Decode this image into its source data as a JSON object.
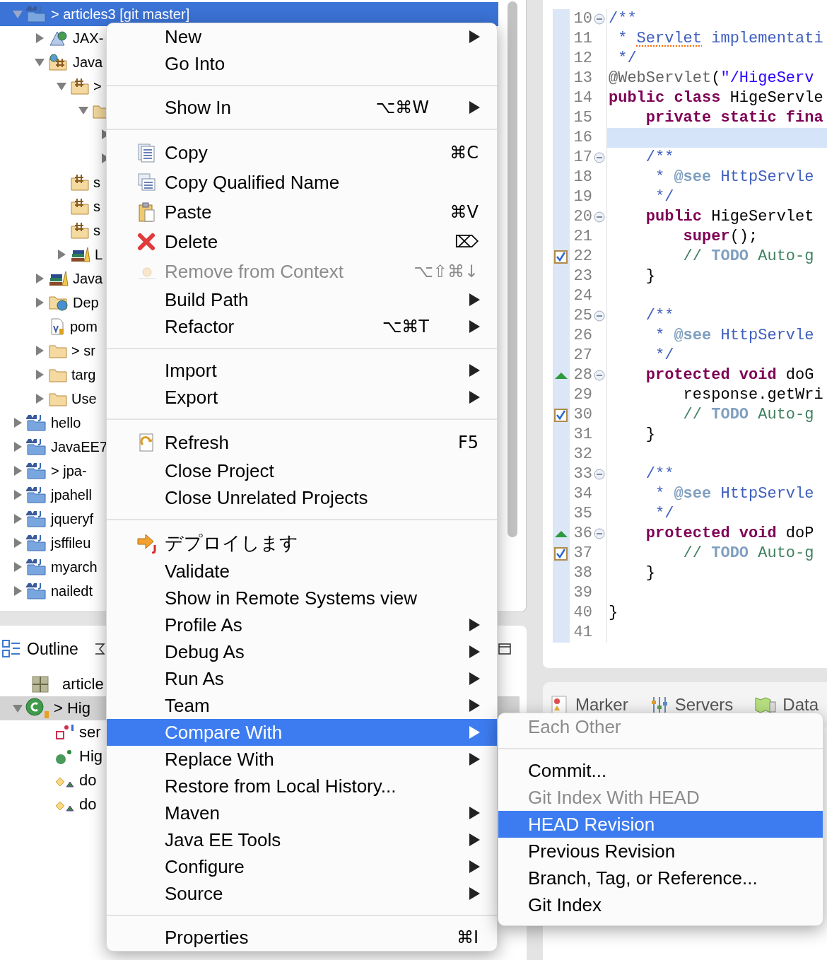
{
  "explorer": {
    "tree": [
      {
        "label": "> articles3 [git master]",
        "kind": "project",
        "expanded": true,
        "selected": true,
        "children": [
          {
            "label": "JAX-",
            "kind": "webservice",
            "expanded": false,
            "selected": false
          },
          {
            "label": "Java",
            "kind": "resources",
            "expanded": true,
            "selected": false,
            "children": [
              {
                "label": ">",
                "kind": "package-root",
                "expanded": true,
                "selected": false,
                "children": [
                  {
                    "kind": "package",
                    "expanded": true,
                    "selected": false,
                    "children": [
                      {
                        "expanded": false,
                        "selected": false
                      },
                      {
                        "expanded": false,
                        "selected": false
                      }
                    ]
                  }
                ]
              },
              {
                "label": "s",
                "kind": "package-root",
                "selected": false
              },
              {
                "label": "s",
                "kind": "package-root",
                "selected": false
              },
              {
                "label": "s",
                "kind": "package-root",
                "selected": false
              },
              {
                "label": "L",
                "kind": "library",
                "expanded": false,
                "selected": false
              }
            ]
          },
          {
            "label": "Java",
            "kind": "library",
            "expanded": false,
            "selected": false
          },
          {
            "label": "Dep",
            "kind": "deploy",
            "expanded": false,
            "selected": false
          },
          {
            "label": "pom",
            "kind": "file",
            "selected": false
          },
          {
            "label": "> sr",
            "kind": "folder",
            "expanded": false,
            "selected": false
          },
          {
            "label": "targ",
            "kind": "folder",
            "expanded": false,
            "selected": false
          },
          {
            "label": "Use",
            "kind": "folder",
            "expanded": false,
            "selected": false
          }
        ]
      },
      {
        "label": "hello",
        "kind": "project",
        "expanded": false,
        "selected": false
      },
      {
        "label": "JavaEE7",
        "kind": "project",
        "expanded": false,
        "selected": false
      },
      {
        "label": "> jpa-",
        "kind": "project",
        "expanded": false,
        "selected": false
      },
      {
        "label": "jpahell",
        "kind": "project",
        "expanded": false,
        "selected": false
      },
      {
        "label": "jqueryf",
        "kind": "project",
        "expanded": false,
        "selected": false
      },
      {
        "label": "jsffileu",
        "kind": "project",
        "expanded": false,
        "selected": false
      },
      {
        "label": "myarch",
        "kind": "project",
        "expanded": false,
        "selected": false
      },
      {
        "label": "nailedt",
        "kind": "project",
        "expanded": false,
        "selected": false
      }
    ]
  },
  "outline": {
    "title": "Outline",
    "items": [
      {
        "label": "article",
        "kind": "package",
        "selected": false
      },
      {
        "label": "> Hig",
        "kind": "class",
        "expanded": true,
        "selected": true,
        "children": [
          {
            "label": "ser",
            "kind": "field",
            "selected": false
          },
          {
            "label": "Hig",
            "kind": "constructor",
            "selected": false
          },
          {
            "label": "do",
            "kind": "method",
            "selected": false
          },
          {
            "label": "do",
            "kind": "method",
            "selected": false
          }
        ]
      }
    ]
  },
  "editor": {
    "lines": [
      {
        "number": "10",
        "fold": true,
        "current": false,
        "code": [
          {
            "text": "/**",
            "kind": "doc"
          }
        ]
      },
      {
        "number": "11",
        "current": false,
        "code": [
          {
            "text": " * ",
            "kind": "doc"
          },
          {
            "text": "Servlet",
            "kind": "doc",
            "misspelled": true
          },
          {
            "text": " implementati",
            "kind": "doc"
          }
        ]
      },
      {
        "number": "12",
        "current": false,
        "code": [
          {
            "text": " */",
            "kind": "doc"
          }
        ]
      },
      {
        "number": "13",
        "current": false,
        "code": [
          {
            "text": "@WebServlet",
            "kind": "annotation"
          },
          {
            "text": "(",
            "kind": "plain"
          },
          {
            "text": "\"/HigeServ",
            "kind": "string"
          }
        ]
      },
      {
        "number": "14",
        "current": false,
        "code": [
          {
            "text": "public class",
            "kind": "keyword"
          },
          {
            "text": " HigeServle",
            "kind": "plain"
          }
        ]
      },
      {
        "number": "15",
        "current": false,
        "code": [
          {
            "text": "    private static fina",
            "kind": "keyword"
          }
        ]
      },
      {
        "number": "16",
        "current": true
      },
      {
        "number": "17",
        "fold": true,
        "current": false,
        "code": [
          {
            "text": "    /**",
            "kind": "doc"
          }
        ]
      },
      {
        "number": "18",
        "current": false,
        "code": [
          {
            "text": "     * ",
            "kind": "doc"
          },
          {
            "text": "@see",
            "kind": "doctag"
          },
          {
            "text": " HttpServle",
            "kind": "doc"
          }
        ]
      },
      {
        "number": "19",
        "current": false,
        "code": [
          {
            "text": "     */",
            "kind": "doc"
          }
        ]
      },
      {
        "number": "20",
        "fold": true,
        "current": false,
        "code": [
          {
            "text": "    public",
            "kind": "keyword"
          },
          {
            "text": " HigeServlet",
            "kind": "plain"
          }
        ]
      },
      {
        "number": "21",
        "current": false,
        "code": [
          {
            "text": "        super",
            "kind": "keyword"
          },
          {
            "text": "();",
            "kind": "plain"
          }
        ]
      },
      {
        "number": "22",
        "kind": "task",
        "current": false,
        "code": [
          {
            "text": "        // ",
            "kind": "comment"
          },
          {
            "text": "TODO",
            "kind": "todo"
          },
          {
            "text": " Auto-g",
            "kind": "comment"
          }
        ]
      },
      {
        "number": "23",
        "current": false,
        "code": [
          {
            "text": "    }",
            "kind": "plain"
          }
        ]
      },
      {
        "number": "24",
        "current": false
      },
      {
        "number": "25",
        "fold": true,
        "current": false,
        "code": [
          {
            "text": "    /**",
            "kind": "doc"
          }
        ]
      },
      {
        "number": "26",
        "current": false,
        "code": [
          {
            "text": "     * ",
            "kind": "doc"
          },
          {
            "text": "@see",
            "kind": "doctag"
          },
          {
            "text": " HttpServle",
            "kind": "doc"
          }
        ]
      },
      {
        "number": "27",
        "current": false,
        "code": [
          {
            "text": "     */",
            "kind": "doc"
          }
        ]
      },
      {
        "number": "28",
        "fold": true,
        "kind": "override",
        "current": false,
        "code": [
          {
            "text": "    protected void",
            "kind": "keyword"
          },
          {
            "text": " doG",
            "kind": "plain"
          }
        ]
      },
      {
        "number": "29",
        "current": false,
        "code": [
          {
            "text": "        response.getWri",
            "kind": "plain"
          }
        ]
      },
      {
        "number": "30",
        "kind": "task",
        "current": false,
        "code": [
          {
            "text": "        // ",
            "kind": "comment"
          },
          {
            "text": "TODO",
            "kind": "todo"
          },
          {
            "text": " Auto-g",
            "kind": "comment"
          }
        ]
      },
      {
        "number": "31",
        "current": false,
        "code": [
          {
            "text": "    }",
            "kind": "plain"
          }
        ]
      },
      {
        "number": "32",
        "current": false
      },
      {
        "number": "33",
        "fold": true,
        "current": false,
        "code": [
          {
            "text": "    /**",
            "kind": "doc"
          }
        ]
      },
      {
        "number": "34",
        "current": false,
        "code": [
          {
            "text": "     * ",
            "kind": "doc"
          },
          {
            "text": "@see",
            "kind": "doctag"
          },
          {
            "text": " HttpServle",
            "kind": "doc"
          }
        ]
      },
      {
        "number": "35",
        "current": false,
        "code": [
          {
            "text": "     */",
            "kind": "doc"
          }
        ]
      },
      {
        "number": "36",
        "fold": true,
        "kind": "override",
        "current": false,
        "code": [
          {
            "text": "    protected void",
            "kind": "keyword"
          },
          {
            "text": " doP",
            "kind": "plain"
          }
        ]
      },
      {
        "number": "37",
        "kind": "task",
        "current": false,
        "code": [
          {
            "text": "        // ",
            "kind": "comment"
          },
          {
            "text": "TODO",
            "kind": "todo"
          },
          {
            "text": " Auto-g",
            "kind": "comment"
          }
        ]
      },
      {
        "number": "38",
        "current": false,
        "code": [
          {
            "text": "    }",
            "kind": "plain"
          }
        ]
      },
      {
        "number": "39",
        "current": false
      },
      {
        "number": "40",
        "current": false,
        "code": [
          {
            "text": "}",
            "kind": "plain"
          }
        ]
      },
      {
        "number": "41",
        "current": false
      }
    ]
  },
  "bottom_panel": {
    "tabs": [
      {
        "label": "Marker",
        "kind": "markers"
      },
      {
        "label": "Servers",
        "kind": "servers"
      },
      {
        "label": "Data",
        "kind": "data"
      }
    ]
  },
  "context_menu": {
    "items": [
      {
        "kind": "item",
        "label": "New",
        "submenu": true,
        "disabled": false,
        "selected": false
      },
      {
        "kind": "item",
        "label": "Go Into",
        "submenu": false,
        "disabled": false,
        "selected": false
      },
      {
        "kind": "separator"
      },
      {
        "kind": "item",
        "label": "Show In",
        "shortcut": "⌥⌘W",
        "submenu": true,
        "disabled": false,
        "selected": false
      },
      {
        "kind": "separator"
      },
      {
        "kind": "copy",
        "label": "Copy",
        "shortcut": "⌘C",
        "submenu": false,
        "disabled": false,
        "selected": false
      },
      {
        "kind": "copy-name",
        "label": "Copy Qualified Name",
        "submenu": false,
        "disabled": false,
        "selected": false
      },
      {
        "kind": "paste",
        "label": "Paste",
        "shortcut": "⌘V",
        "submenu": false,
        "disabled": false,
        "selected": false
      },
      {
        "kind": "delete",
        "label": "Delete",
        "shortcut": "⌦",
        "submenu": false,
        "disabled": false,
        "selected": false
      },
      {
        "kind": "remove",
        "label": "Remove from Context",
        "shortcut": "⌥⇧⌘↓",
        "submenu": false,
        "disabled": true,
        "selected": false
      },
      {
        "kind": "item",
        "label": "Build Path",
        "submenu": true,
        "disabled": false,
        "selected": false
      },
      {
        "kind": "item",
        "label": "Refactor",
        "shortcut": "⌥⌘T",
        "submenu": true,
        "disabled": false,
        "selected": false
      },
      {
        "kind": "separator"
      },
      {
        "kind": "item",
        "label": "Import",
        "submenu": true,
        "disabled": false,
        "selected": false
      },
      {
        "kind": "item",
        "label": "Export",
        "submenu": true,
        "disabled": false,
        "selected": false
      },
      {
        "kind": "separator"
      },
      {
        "kind": "refresh",
        "label": "Refresh",
        "shortcut": "F5",
        "submenu": false,
        "disabled": false,
        "selected": false
      },
      {
        "kind": "item",
        "label": "Close Project",
        "submenu": false,
        "disabled": false,
        "selected": false
      },
      {
        "kind": "item",
        "label": "Close Unrelated Projects",
        "submenu": false,
        "disabled": false,
        "selected": false
      },
      {
        "kind": "separator"
      },
      {
        "kind": "deploy",
        "label": "デプロイします",
        "submenu": false,
        "disabled": false,
        "selected": false
      },
      {
        "kind": "item",
        "label": "Validate",
        "submenu": false,
        "disabled": false,
        "selected": false
      },
      {
        "kind": "item",
        "label": "Show in Remote Systems view",
        "submenu": false,
        "disabled": false,
        "selected": false
      },
      {
        "kind": "item",
        "label": "Profile As",
        "submenu": true,
        "disabled": false,
        "selected": false
      },
      {
        "kind": "item",
        "label": "Debug As",
        "submenu": true,
        "disabled": false,
        "selected": false
      },
      {
        "kind": "item",
        "label": "Run As",
        "submenu": true,
        "disabled": false,
        "selected": false
      },
      {
        "kind": "item",
        "label": "Team",
        "submenu": true,
        "disabled": false,
        "selected": false
      },
      {
        "kind": "item",
        "label": "Compare With",
        "submenu": true,
        "disabled": false,
        "selected": true
      },
      {
        "kind": "item",
        "label": "Replace With",
        "submenu": true,
        "disabled": false,
        "selected": false
      },
      {
        "kind": "item",
        "label": "Restore from Local History...",
        "submenu": false,
        "disabled": false,
        "selected": false
      },
      {
        "kind": "item",
        "label": "Maven",
        "submenu": true,
        "disabled": false,
        "selected": false
      },
      {
        "kind": "item",
        "label": "Java EE Tools",
        "submenu": true,
        "disabled": false,
        "selected": false
      },
      {
        "kind": "item",
        "label": "Configure",
        "submenu": true,
        "disabled": false,
        "selected": false
      },
      {
        "kind": "item",
        "label": "Source",
        "submenu": true,
        "disabled": false,
        "selected": false
      },
      {
        "kind": "separator"
      },
      {
        "kind": "item",
        "label": "Properties",
        "shortcut": "⌘I",
        "submenu": false,
        "disabled": false,
        "selected": false
      }
    ]
  },
  "submenu": {
    "items": [
      {
        "kind": "item",
        "label": "Each Other",
        "disabled": true,
        "selected": false
      },
      {
        "kind": "separator"
      },
      {
        "kind": "item",
        "label": "Commit...",
        "disabled": false,
        "selected": false
      },
      {
        "kind": "item",
        "label": "Git Index With HEAD",
        "disabled": true,
        "selected": false
      },
      {
        "kind": "item",
        "label": "HEAD Revision",
        "disabled": false,
        "selected": true
      },
      {
        "kind": "item",
        "label": "Previous Revision",
        "disabled": false,
        "selected": false
      },
      {
        "kind": "item",
        "label": "Branch, Tag, or Reference...",
        "disabled": false,
        "selected": false
      },
      {
        "kind": "item",
        "label": "Git Index",
        "disabled": false,
        "selected": false
      }
    ]
  }
}
